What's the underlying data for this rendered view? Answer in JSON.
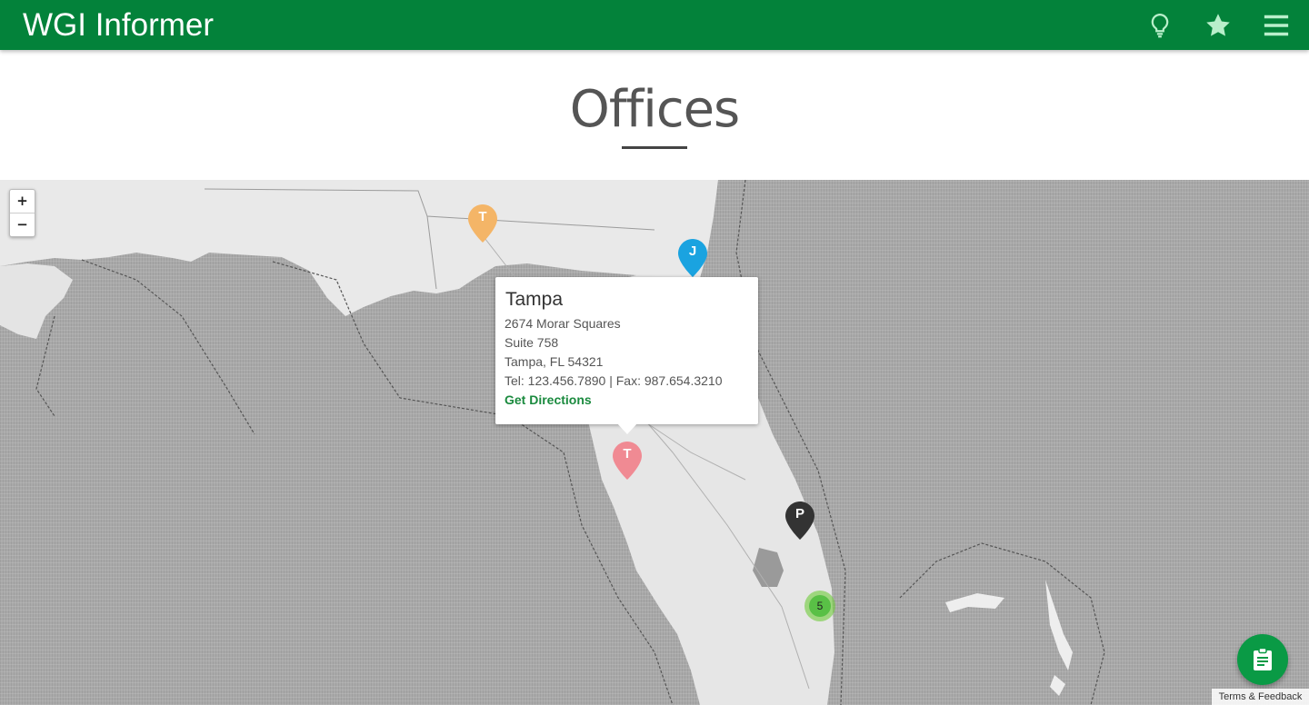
{
  "header": {
    "brand": "WGI Informer",
    "icons": [
      "lightbulb-icon",
      "star-icon",
      "menu-icon"
    ]
  },
  "page": {
    "title": "Offices"
  },
  "map": {
    "zoom_in": "+",
    "zoom_out": "−",
    "markers": [
      {
        "letter": "T",
        "color": "#f4b567"
      },
      {
        "letter": "J",
        "color": "#1aa3e0"
      },
      {
        "letter": "T",
        "color": "#f08a93"
      },
      {
        "letter": "P",
        "color": "#333333"
      }
    ],
    "cluster": {
      "count": "5"
    },
    "popup": {
      "title": "Tampa",
      "address_line1": "2674 Morar Squares",
      "address_line2": "Suite 758",
      "city_line": "Tampa, FL 54321",
      "phone_line": "Tel: 123.456.7890 | Fax: 987.654.3210",
      "directions": "Get Directions"
    },
    "terms": "Terms & Feedback"
  },
  "colors": {
    "brand_green": "#03823a",
    "fab_green": "#0a9a45"
  }
}
